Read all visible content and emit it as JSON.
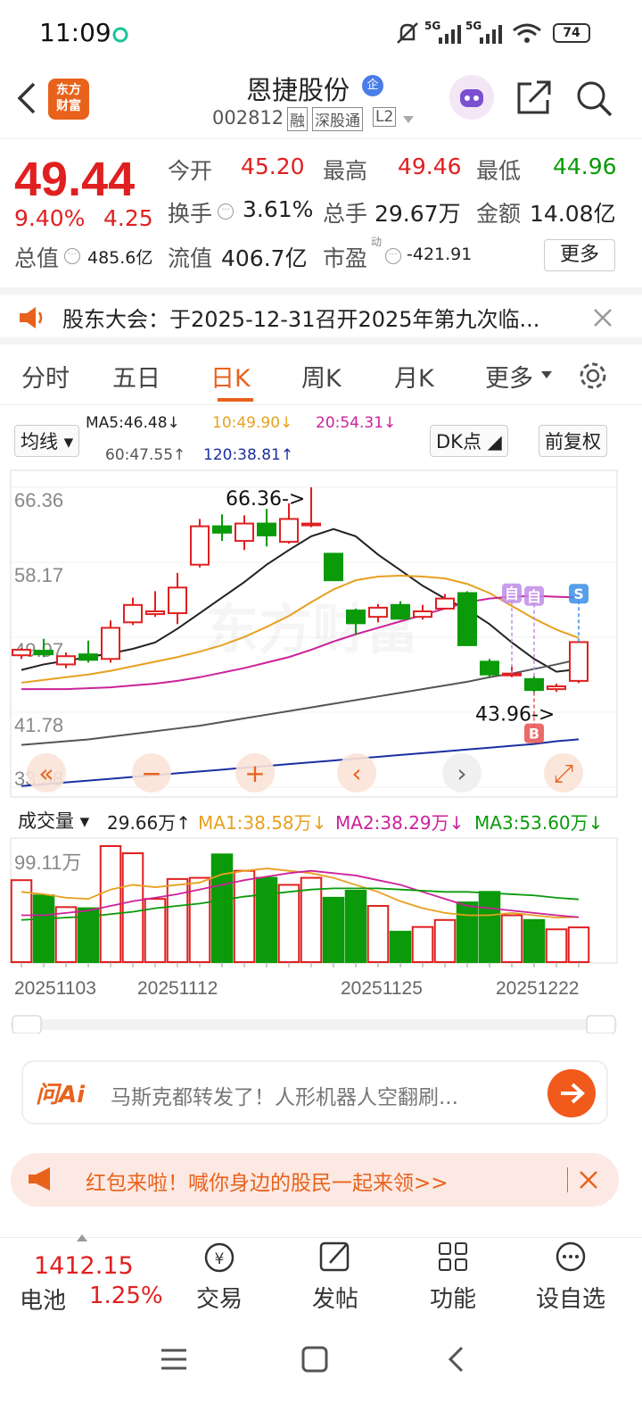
{
  "status_bar": {
    "time": "11:09",
    "battery": "74",
    "net1": "5G",
    "net2": "5G"
  },
  "header": {
    "logo_text": "东方\n财富",
    "stock_name": "恩捷股份",
    "stock_code": "002812",
    "badge_margin": "融",
    "badge_connect": "深股通",
    "badge_level": "L2",
    "ent_badge": "企"
  },
  "quote": {
    "price": "49.44",
    "pct": "9.40%",
    "chg": "4.25",
    "open_label": "今开",
    "open": "45.20",
    "high_label": "最高",
    "high": "49.46",
    "low_label": "最低",
    "low": "44.96",
    "turnover_label": "换手",
    "turnover": "3.61%",
    "volume_label": "总手",
    "volume": "29.67万",
    "amount_label": "金额",
    "amount": "14.08亿",
    "mktcap_label": "总值",
    "mktcap": "485.6亿",
    "float_label": "流值",
    "float": "406.7亿",
    "pe_label": "市盈",
    "pe_sup": "动",
    "pe": "-421.91",
    "more_button": "更多"
  },
  "notice": {
    "text": "股东大会：于2025-12-31召开2025年第九次临..."
  },
  "tabs": [
    {
      "label": "分时"
    },
    {
      "label": "五日"
    },
    {
      "label": "日K"
    },
    {
      "label": "周K"
    },
    {
      "label": "月K"
    },
    {
      "label": "更多"
    }
  ],
  "chart_controls": {
    "ma_select": "均线",
    "dk_button": "DK点",
    "adjust_button": "前复权",
    "ma5": "MA5:46.48↓",
    "ma10": "10:49.90↓",
    "ma20": "20:54.31↓",
    "ma60": "60:47.55↑",
    "ma120": "120:38.81↑",
    "volume_select": "成交量",
    "vol": "29.66万↑",
    "vma1": "MA1:38.58万↓",
    "vma2": "MA2:38.29万↓",
    "vma3": "MA3:53.60万↓",
    "vol_max": "99.11万"
  },
  "colors": {
    "up": "#e02020",
    "down": "#0a9a0a",
    "accent": "#e8621c",
    "ma5": "#222222",
    "ma10": "#e8a020",
    "ma20": "#cc2299",
    "ma60": "#555555",
    "ma120": "#1a2fa0"
  },
  "chart_data": {
    "type": "candlestick",
    "y_ticks": [
      "66.36",
      "58.17",
      "49.97",
      "41.78",
      "33.58"
    ],
    "ylim": [
      33.58,
      66.36
    ],
    "x_ticks": [
      "20251103",
      "20251112",
      "20251125",
      "20251222"
    ],
    "annotations": [
      "66.36->",
      "43.96->"
    ],
    "markers": [
      {
        "label": "自"
      },
      {
        "label": "自"
      },
      {
        "label": "S"
      },
      {
        "label": "B"
      }
    ],
    "candles": [
      {
        "o": 48.0,
        "c": 48.6,
        "h": 48.8,
        "l": 47.6
      },
      {
        "o": 48.5,
        "c": 48.1,
        "h": 49.8,
        "l": 47.8
      },
      {
        "o": 47.0,
        "c": 47.9,
        "h": 48.3,
        "l": 46.6
      },
      {
        "o": 48.1,
        "c": 47.5,
        "h": 49.6,
        "l": 47.2
      },
      {
        "o": 47.6,
        "c": 51.0,
        "h": 51.8,
        "l": 47.2
      },
      {
        "o": 51.6,
        "c": 53.5,
        "h": 54.3,
        "l": 51.3
      },
      {
        "o": 52.5,
        "c": 52.8,
        "h": 55.0,
        "l": 52.2
      },
      {
        "o": 52.6,
        "c": 55.4,
        "h": 57.0,
        "l": 51.4
      },
      {
        "o": 57.9,
        "c": 62.1,
        "h": 62.9,
        "l": 57.6
      },
      {
        "o": 62.1,
        "c": 61.4,
        "h": 63.4,
        "l": 60.5
      },
      {
        "o": 60.5,
        "c": 62.4,
        "h": 63.3,
        "l": 59.5
      },
      {
        "o": 62.4,
        "c": 61.1,
        "h": 64.0,
        "l": 59.9
      },
      {
        "o": 60.4,
        "c": 62.9,
        "h": 64.6,
        "l": 60.2
      },
      {
        "o": 62.4,
        "c": 62.4,
        "h": 66.36,
        "l": 62.0
      },
      {
        "o": 59.1,
        "c": 56.2,
        "h": 59.1,
        "l": 56.1
      },
      {
        "o": 52.9,
        "c": 51.5,
        "h": 53.1,
        "l": 50.2
      },
      {
        "o": 52.2,
        "c": 53.2,
        "h": 53.6,
        "l": 51.6
      },
      {
        "o": 53.5,
        "c": 52.0,
        "h": 53.9,
        "l": 51.9
      },
      {
        "o": 52.2,
        "c": 52.8,
        "h": 53.5,
        "l": 51.9
      },
      {
        "o": 53.1,
        "c": 54.2,
        "h": 54.7,
        "l": 53.0
      },
      {
        "o": 54.8,
        "c": 49.1,
        "h": 55.0,
        "l": 49.1
      },
      {
        "o": 47.3,
        "c": 45.9,
        "h": 47.6,
        "l": 45.5
      },
      {
        "o": 46.0,
        "c": 46.0,
        "h": 46.8,
        "l": 45.6
      },
      {
        "o": 45.4,
        "c": 44.2,
        "h": 45.7,
        "l": 43.96
      },
      {
        "o": 44.3,
        "c": 44.6,
        "h": 44.9,
        "l": 44.0
      },
      {
        "o": 45.2,
        "c": 49.44,
        "h": 49.46,
        "l": 44.96
      }
    ],
    "ma_series": [
      {
        "name": "MA5",
        "values": [
          46.4,
          47.0,
          47.4,
          47.8,
          48.2,
          48.7,
          49.4,
          50.9,
          52.6,
          54.3,
          56.0,
          57.9,
          59.5,
          61.0,
          61.8,
          61.0,
          59.0,
          57.3,
          55.6,
          54.2,
          53.0,
          51.4,
          49.4,
          47.6,
          46.2,
          46.48
        ]
      },
      {
        "name": "MA10",
        "values": [
          45.0,
          45.3,
          45.6,
          45.9,
          46.3,
          46.8,
          47.3,
          47.8,
          48.4,
          49.1,
          50.0,
          51.1,
          52.3,
          53.8,
          55.2,
          56.2,
          56.6,
          56.7,
          56.6,
          56.4,
          55.8,
          54.8,
          53.4,
          52.0,
          50.8,
          49.9
        ]
      },
      {
        "name": "MA20",
        "values": [
          44.3,
          44.3,
          44.3,
          44.4,
          44.5,
          44.7,
          44.9,
          45.2,
          45.6,
          46.1,
          46.6,
          47.2,
          47.8,
          48.6,
          49.5,
          50.3,
          51.0,
          51.7,
          52.4,
          53.1,
          53.8,
          54.2,
          54.4,
          54.5,
          54.4,
          54.31
        ]
      },
      {
        "name": "MA60",
        "values": [
          38.2,
          38.4,
          38.6,
          38.8,
          39.1,
          39.4,
          39.7,
          40.0,
          40.3,
          40.7,
          41.1,
          41.5,
          41.9,
          42.3,
          42.7,
          43.1,
          43.5,
          43.9,
          44.3,
          44.7,
          45.1,
          45.6,
          46.0,
          46.5,
          47.0,
          47.55
        ]
      },
      {
        "name": "MA120",
        "values": [
          33.7,
          33.9,
          34.1,
          34.3,
          34.5,
          34.7,
          34.9,
          35.1,
          35.3,
          35.5,
          35.7,
          35.9,
          36.1,
          36.3,
          36.5,
          36.7,
          36.9,
          37.1,
          37.3,
          37.5,
          37.7,
          37.9,
          38.1,
          38.3,
          38.6,
          38.81
        ]
      }
    ],
    "volume": {
      "max": 99.11,
      "values": [
        70,
        57,
        47,
        46,
        99.11,
        93,
        54,
        71,
        72,
        92,
        78,
        72,
        66,
        72,
        55,
        61,
        48,
        26,
        30,
        36,
        51,
        60,
        40,
        36,
        28,
        29.66
      ],
      "ma_series": [
        {
          "name": "MA1",
          "values": [
            60,
            58,
            55,
            54,
            62,
            66,
            64,
            66,
            68,
            75,
            78,
            80,
            78,
            76,
            72,
            66,
            60,
            52,
            46,
            42,
            40,
            40,
            42,
            40,
            38,
            38.58
          ]
        },
        {
          "name": "MA2",
          "values": [
            40,
            40,
            42,
            44,
            48,
            52,
            55,
            58,
            62,
            66,
            70,
            73,
            76,
            78,
            76,
            74,
            70,
            66,
            60,
            54,
            48,
            46,
            44,
            42,
            40,
            38.29
          ]
        },
        {
          "name": "MA3",
          "values": [
            36,
            37,
            38,
            39,
            41,
            43,
            46,
            48,
            50,
            53,
            56,
            58,
            60,
            62,
            63,
            63,
            63,
            62,
            61,
            60,
            60,
            59,
            58,
            57,
            55,
            53.6
          ]
        }
      ]
    }
  },
  "chart_nav": {
    "icons": [
      "double-left-icon",
      "zoom-out-icon",
      "zoom-in-icon",
      "prev-icon",
      "next-icon",
      "fullscreen-icon"
    ]
  },
  "ai_box": {
    "brand": "问Ai",
    "text": "马斯克都转发了！人形机器人空翻刷..."
  },
  "red_packet": {
    "text": "红包来啦！喊你身边的股民一起来领>>"
  },
  "bottom_bar": {
    "index_value": "1412.15",
    "index_name": "电池",
    "index_pct": "1.25%",
    "items": [
      {
        "label": "交易"
      },
      {
        "label": "发帖"
      },
      {
        "label": "功能"
      },
      {
        "label": "设自选"
      }
    ]
  }
}
